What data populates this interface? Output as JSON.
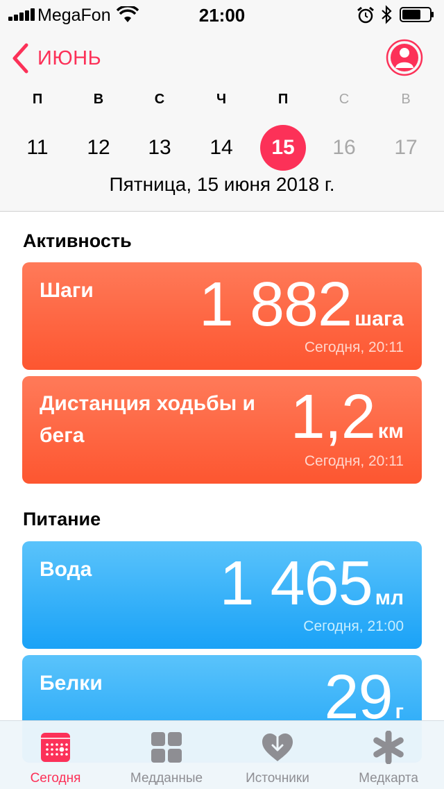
{
  "status_bar": {
    "carrier": "MegaFon",
    "time": "21:00"
  },
  "header": {
    "back_label": "ИЮНЬ",
    "weekdays": [
      "П",
      "В",
      "С",
      "Ч",
      "П",
      "С",
      "В"
    ],
    "days": [
      "11",
      "12",
      "13",
      "14",
      "15",
      "16",
      "17"
    ],
    "selected_day": "15",
    "full_date": "Пятница, 15 июня 2018 г."
  },
  "sections": {
    "activity": {
      "title": "Активность",
      "steps": {
        "label": "Шаги",
        "value": "1 882",
        "unit": "шага",
        "timestamp": "Сегодня, 20:11"
      },
      "distance": {
        "label": "Дистанция ходьбы и бега",
        "value": "1,2",
        "unit": "км",
        "timestamp": "Сегодня, 20:11"
      }
    },
    "nutrition": {
      "title": "Питание",
      "water": {
        "label": "Вода",
        "value": "1 465",
        "unit": "мл",
        "timestamp": "Сегодня, 21:00"
      },
      "protein": {
        "label": "Белки",
        "value": "29",
        "unit": "г"
      }
    }
  },
  "tabbar": {
    "today": "Сегодня",
    "health_data": "Медданные",
    "sources": "Источники",
    "medical_id": "Медкарта"
  },
  "colors": {
    "accent": "#fc3158",
    "activity": "#fd5630",
    "nutrition": "#1aa2f7"
  }
}
